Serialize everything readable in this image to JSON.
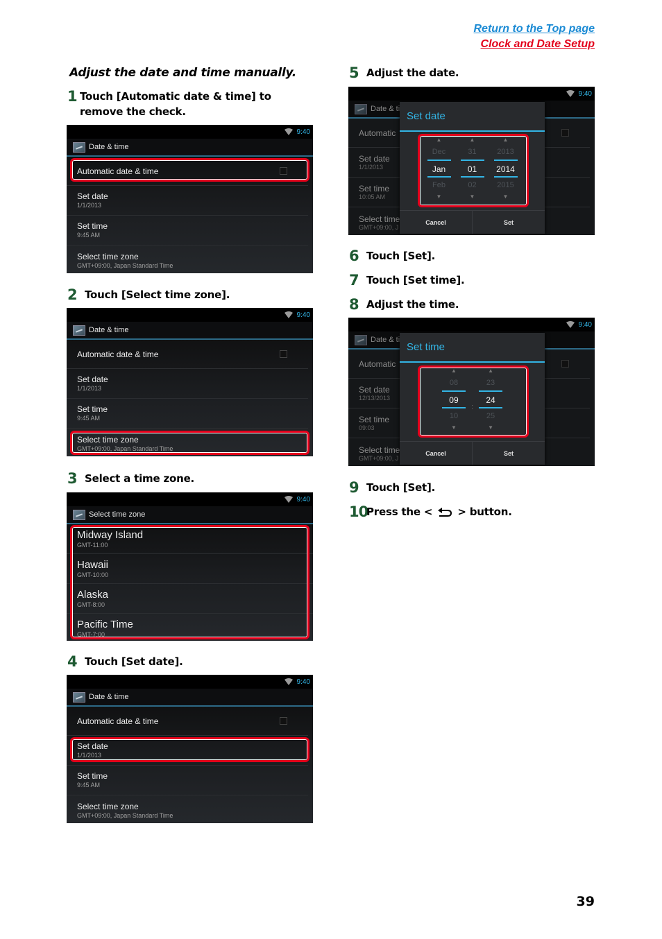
{
  "header": {
    "link_top": "Return to the Top page",
    "link_section": "Clock and Date Setup"
  },
  "section_title": "Adjust the date and time manually.",
  "steps": [
    {
      "num": "1",
      "text": "Touch [Automatic date & time] to remove the check."
    },
    {
      "num": "2",
      "text": "Touch [Select time zone]."
    },
    {
      "num": "3",
      "text": "Select a time zone."
    },
    {
      "num": "4",
      "text": "Touch [Set date]."
    },
    {
      "num": "5",
      "text": "Adjust the date."
    },
    {
      "num": "6",
      "text": "Touch [Set]."
    },
    {
      "num": "7",
      "text": "Touch [Set time]."
    },
    {
      "num": "8",
      "text": "Adjust the time."
    },
    {
      "num": "9",
      "text": "Touch [Set]."
    },
    {
      "num": "10",
      "text_before": "Press the <",
      "text_after": "> button.",
      "icon": "back-icon"
    }
  ],
  "status_clock": "9:40",
  "date_time_screen": {
    "title": "Date & time",
    "auto_label": "Automatic date & time",
    "auto_checked": false,
    "set_date_label": "Set date",
    "set_date_value": "1/1/2013",
    "set_time_label": "Set time",
    "set_time_value": "9:45 AM",
    "tz_label": "Select time zone",
    "tz_value": "GMT+09:00, Japan Standard Time"
  },
  "timezone_screen": {
    "title": "Select time zone",
    "zones": [
      {
        "name": "Midway Island",
        "offset": "GMT-11:00"
      },
      {
        "name": "Hawaii",
        "offset": "GMT-10:00"
      },
      {
        "name": "Alaska",
        "offset": "GMT-8:00"
      },
      {
        "name": "Pacific Time",
        "offset": "GMT-7:00"
      }
    ]
  },
  "set_date_dialog": {
    "title": "Set date",
    "bg_title": "Date & ti",
    "bg_auto": "Automatic",
    "bg_set_date": "Set date",
    "bg_set_date_value": "1/1/2013",
    "bg_set_time": "Set time",
    "bg_set_time_value": "10:05 AM",
    "bg_tz": "Select time",
    "bg_tz_value": "GMT+09:00, J",
    "columns": [
      {
        "prev": "Dec",
        "sel": "Jan",
        "next": "Feb"
      },
      {
        "prev": "31",
        "sel": "01",
        "next": "02"
      },
      {
        "prev": "2013",
        "sel": "2014",
        "next": "2015"
      }
    ],
    "cancel": "Cancel",
    "set": "Set"
  },
  "set_time_dialog": {
    "title": "Set time",
    "bg_title": "Date & ti",
    "bg_auto": "Automatic",
    "bg_set_date": "Set date",
    "bg_set_date_value": "12/13/2013",
    "bg_set_time": "Set time",
    "bg_set_time_value": "09:03",
    "bg_tz": "Select time",
    "bg_tz_value": "GMT+09:00, J",
    "columns": [
      {
        "prev": "08",
        "sel": "09",
        "next": "10"
      },
      {
        "prev": "23",
        "sel": "24",
        "next": "25"
      }
    ],
    "separator": ":",
    "cancel": "Cancel",
    "set": "Set"
  },
  "page_number": "39",
  "colors": {
    "link_blue": "#1a8ad4",
    "link_red": "#e3001b",
    "step_green": "#1e5a32",
    "highlight_red": "#e3001b",
    "holo_blue": "#33b5e5"
  }
}
